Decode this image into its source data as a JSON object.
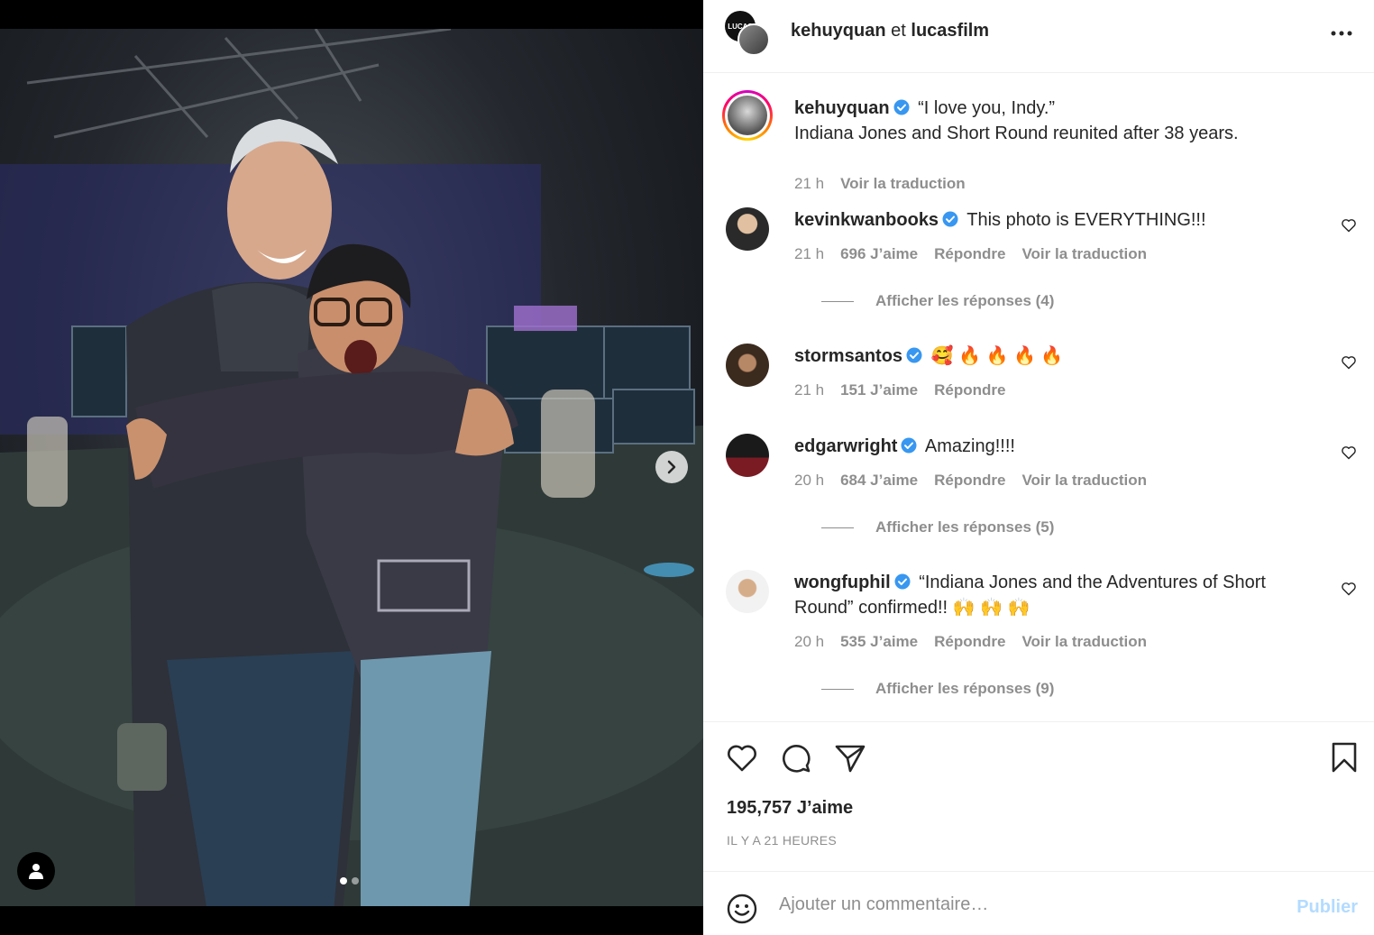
{
  "post_header": {
    "username": "kehuyquan",
    "connector": "et",
    "collaborator": "lucasfilm",
    "more_icon": "more-horizontal-icon",
    "brand_avatar_text": "LUCAS"
  },
  "media": {
    "next_icon": "chevron-right-icon",
    "tag_icon": "user-tag-icon",
    "slide_count": 2,
    "active_slide": 1
  },
  "caption": {
    "username": "kehuyquan",
    "line1": "“I love you, Indy.”",
    "line2": "Indiana Jones and Short Round reunited after 38 years.",
    "time": "21 h",
    "translate": "Voir la traduction"
  },
  "comments": [
    {
      "username": "kevinkwanbooks",
      "text": "This photo is EVERYTHING!!!",
      "time": "21 h",
      "likes": "696 J’aime",
      "reply": "Répondre",
      "translate": "Voir la traduction",
      "replies": "Afficher les réponses (4)"
    },
    {
      "username": "stormsantos",
      "text": "🥰 🔥 🔥 🔥 🔥",
      "time": "21 h",
      "likes": "151 J’aime",
      "reply": "Répondre"
    },
    {
      "username": "edgarwright",
      "text": "Amazing!!!!",
      "time": "20 h",
      "likes": "684 J’aime",
      "reply": "Répondre",
      "translate": "Voir la traduction",
      "replies": "Afficher les réponses (5)"
    },
    {
      "username": "wongfuphil",
      "text_line1": "“Indiana Jones and the Adventures of Short",
      "text_line2": "Round” confirmed!! 🙌 🙌 🙌",
      "time": "20 h",
      "likes": "535 J’aime",
      "reply": "Répondre",
      "translate": "Voir la traduction",
      "replies": "Afficher les réponses (9)"
    }
  ],
  "actions": {
    "like_icon": "heart-icon",
    "comment_icon": "comment-icon",
    "share_icon": "send-icon",
    "save_icon": "bookmark-icon",
    "likes": "195,757 J’aime",
    "time_ago": "IL Y A 21 HEURES"
  },
  "add_comment": {
    "emoji_icon": "smiley-icon",
    "placeholder": "Ajouter un commentaire…",
    "publish": "Publier"
  },
  "colors": {
    "verified": "#3897f0",
    "muted": "#8e8e8e",
    "publish_disabled": "#b3dbff"
  }
}
